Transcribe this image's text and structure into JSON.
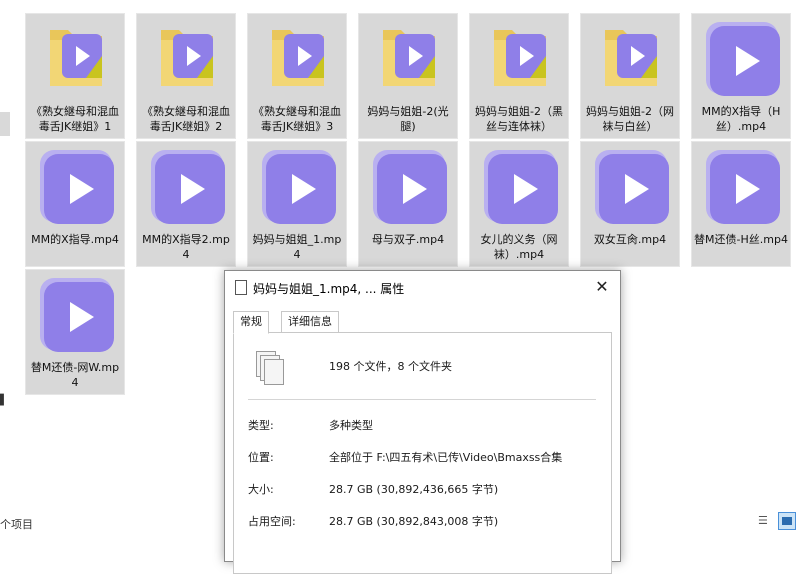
{
  "files": [
    {
      "label": "《熟女継母和混血毒舌JK继姐》1",
      "icon": "folder-video-icon"
    },
    {
      "label": "《熟女継母和混血毒舌JK继姐》2",
      "icon": "folder-video-icon"
    },
    {
      "label": "《熟女継母和混血毒舌JK继姐》3",
      "icon": "folder-video-icon"
    },
    {
      "label": "妈妈与姐姐-2(光腿)",
      "icon": "folder-video-icon"
    },
    {
      "label": "妈妈与姐姐-2（黑丝与连体袜）",
      "icon": "folder-video-icon"
    },
    {
      "label": "妈妈与姐姐-2（网袜与白丝）",
      "icon": "folder-video-icon"
    },
    {
      "label": "MM的X指导（H丝）.mp4",
      "icon": "video-file-icon"
    },
    {
      "label": "MM的X指导.mp4",
      "icon": "video-file-icon"
    },
    {
      "label": "MM的X指导2.mp4",
      "icon": "video-file-icon"
    },
    {
      "label": "妈妈与姐姐_1.mp4",
      "icon": "video-file-icon"
    },
    {
      "label": "母与双子.mp4",
      "icon": "video-file-icon"
    },
    {
      "label": "女儿的义务（网袜）.mp4",
      "icon": "video-file-icon"
    },
    {
      "label": "双女互肏.mp4",
      "icon": "video-file-icon"
    },
    {
      "label": "替M还债-H丝.mp4",
      "icon": "video-file-icon"
    },
    {
      "label": "替M还债-网W.mp4",
      "icon": "video-file-icon"
    }
  ],
  "statusbar": {
    "count_text": "个项目"
  },
  "dialog": {
    "title": "妈妈与姐姐_1.mp4, ... 属性",
    "close_glyph": "✕",
    "tabs": [
      "常规",
      "详细信息"
    ],
    "summary": "198 个文件，8 个文件夹",
    "rows": [
      {
        "label": "类型:",
        "value": "多种类型"
      },
      {
        "label": "位置:",
        "value": "全部位于 F:\\四五有术\\已传\\Video\\Bmaxss合集"
      },
      {
        "label": "大小:",
        "value": "28.7 GB (30,892,436,665 字节)"
      },
      {
        "label": "占用空间:",
        "value": "28.7 GB (30,892,843,008 字节)"
      }
    ]
  },
  "colors": {
    "folder": "#e9c65a",
    "video_tile": "#8f7fe8",
    "play": "#ffffff",
    "selection": "#d8d8d8"
  }
}
